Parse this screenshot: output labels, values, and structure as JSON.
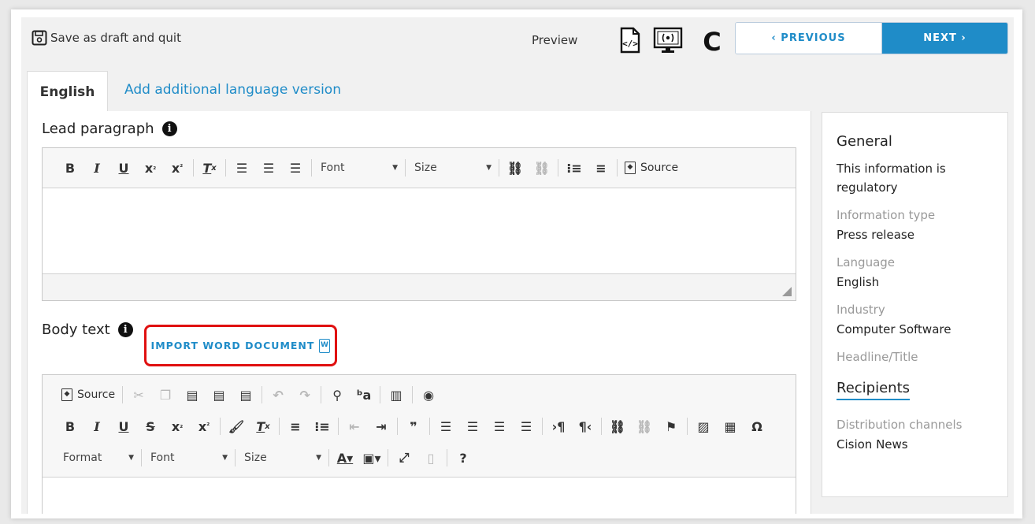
{
  "topbar": {
    "save_label": "Save as draft and quit",
    "preview_label": "Preview",
    "prev_label": "‹ PREVIOUS",
    "next_label": "NEXT ›"
  },
  "tabs": {
    "active": "English",
    "add": "Add additional language version"
  },
  "lead": {
    "label": "Lead paragraph",
    "font_combo": "Font",
    "size_combo": "Size",
    "source": "Source"
  },
  "body": {
    "label": "Body text",
    "import_label": "IMPORT WORD DOCUMENT",
    "source": "Source",
    "format_combo": "Format",
    "font_combo": "Font",
    "size_combo": "Size"
  },
  "sidebar": {
    "general_title": "General",
    "regulatory": "This information is regulatory",
    "info_type_label": "Information type",
    "info_type_value": "Press release",
    "language_label": "Language",
    "language_value": "English",
    "industry_label": "Industry",
    "industry_value": "Computer Software",
    "headline_label": "Headline/Title",
    "recipients_title": "Recipients",
    "channels_label": "Distribution channels",
    "channels_value": "Cision News"
  },
  "colors": {
    "accent": "#1f8cc8",
    "highlight": "#e01010"
  }
}
